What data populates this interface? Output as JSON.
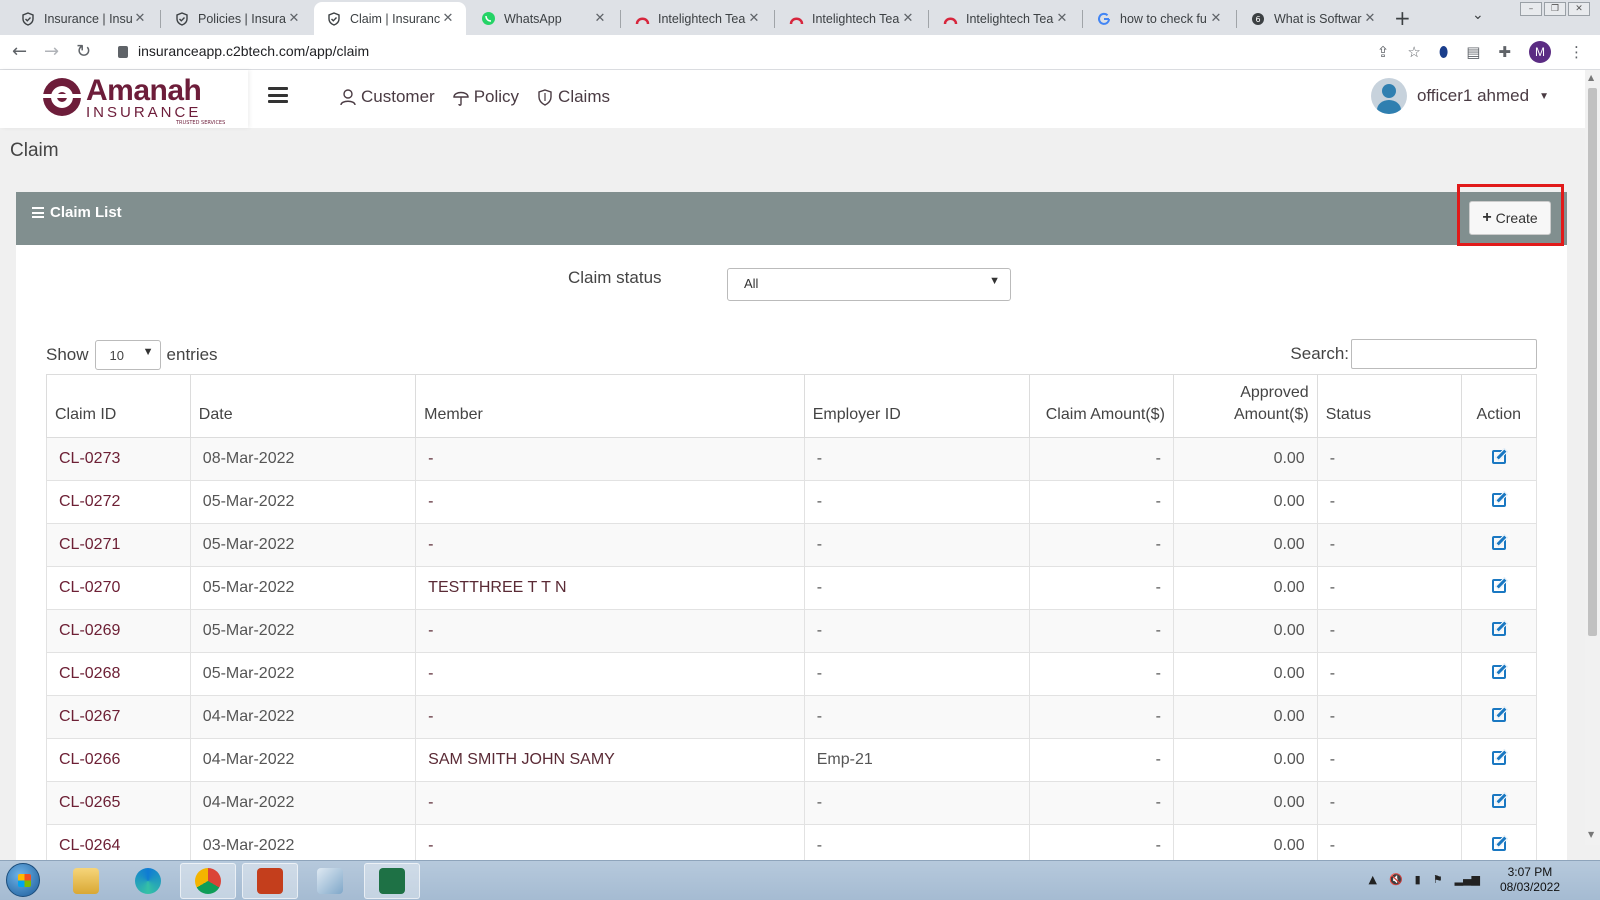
{
  "browser": {
    "tabs": [
      {
        "title": "Insurance | Insura",
        "icon": "shield-icon"
      },
      {
        "title": "Policies | Insuran",
        "icon": "shield-icon"
      },
      {
        "title": "Claim | Insurance",
        "icon": "shield-icon",
        "active": true
      },
      {
        "title": "WhatsApp",
        "icon": "whatsapp-icon"
      },
      {
        "title": "Intelightech Tear",
        "icon": "intelightech-icon"
      },
      {
        "title": "Intelightech Tear",
        "icon": "intelightech-icon"
      },
      {
        "title": "Intelightech Tear",
        "icon": "intelightech-icon"
      },
      {
        "title": "how to check fu",
        "icon": "google-icon"
      },
      {
        "title": "What is Software",
        "icon": "site-icon"
      }
    ],
    "url": "insuranceapp.c2btech.com/app/claim",
    "profile_initial": "M"
  },
  "app": {
    "logo": {
      "name": "Amanah",
      "sub": "INSURANCE",
      "tagline": "TRUSTED SERVICES",
      "color": "#6d1d3a"
    },
    "nav": [
      {
        "label": "Customer",
        "icon": "user-icon"
      },
      {
        "label": "Policy",
        "icon": "umbrella-icon"
      },
      {
        "label": "Claims",
        "icon": "shield-outline-icon"
      }
    ],
    "user": {
      "name": "officer1 ahmed"
    },
    "page_title": "Claim",
    "card": {
      "title": "Claim List",
      "create_label": "Create",
      "header_color": "#818f8f"
    },
    "filter": {
      "label": "Claim status",
      "value": "All"
    },
    "entries": {
      "before": "Show",
      "value": "10",
      "after": "entries"
    },
    "search": {
      "label": "Search:",
      "value": ""
    },
    "table": {
      "headers": [
        "Claim ID",
        "Date",
        "Member",
        "Employer ID",
        "Claim Amount($)",
        "Approved Amount($)",
        "Status",
        "Action"
      ],
      "rows": [
        {
          "id": "CL-0273",
          "date": "08-Mar-2022",
          "member": "-",
          "employer": "-",
          "claim": "-",
          "approved": "0.00",
          "status": "-"
        },
        {
          "id": "CL-0272",
          "date": "05-Mar-2022",
          "member": "-",
          "employer": "-",
          "claim": "-",
          "approved": "0.00",
          "status": "-"
        },
        {
          "id": "CL-0271",
          "date": "05-Mar-2022",
          "member": "-",
          "employer": "-",
          "claim": "-",
          "approved": "0.00",
          "status": "-"
        },
        {
          "id": "CL-0270",
          "date": "05-Mar-2022",
          "member": "TESTTHREE T T N",
          "employer": "-",
          "claim": "-",
          "approved": "0.00",
          "status": "-"
        },
        {
          "id": "CL-0269",
          "date": "05-Mar-2022",
          "member": "-",
          "employer": "-",
          "claim": "-",
          "approved": "0.00",
          "status": "-"
        },
        {
          "id": "CL-0268",
          "date": "05-Mar-2022",
          "member": "-",
          "employer": "-",
          "claim": "-",
          "approved": "0.00",
          "status": "-"
        },
        {
          "id": "CL-0267",
          "date": "04-Mar-2022",
          "member": "-",
          "employer": "-",
          "claim": "-",
          "approved": "0.00",
          "status": "-"
        },
        {
          "id": "CL-0266",
          "date": "04-Mar-2022",
          "member": "SAM SMITH JOHN SAMY",
          "employer": "Emp-21",
          "claim": "-",
          "approved": "0.00",
          "status": "-"
        },
        {
          "id": "CL-0265",
          "date": "04-Mar-2022",
          "member": "-",
          "employer": "-",
          "claim": "-",
          "approved": "0.00",
          "status": "-"
        },
        {
          "id": "CL-0264",
          "date": "03-Mar-2022",
          "member": "-",
          "employer": "-",
          "claim": "-",
          "approved": "0.00",
          "status": "-"
        }
      ]
    }
  },
  "taskbar": {
    "time": "3:07 PM",
    "date": "08/03/2022"
  }
}
